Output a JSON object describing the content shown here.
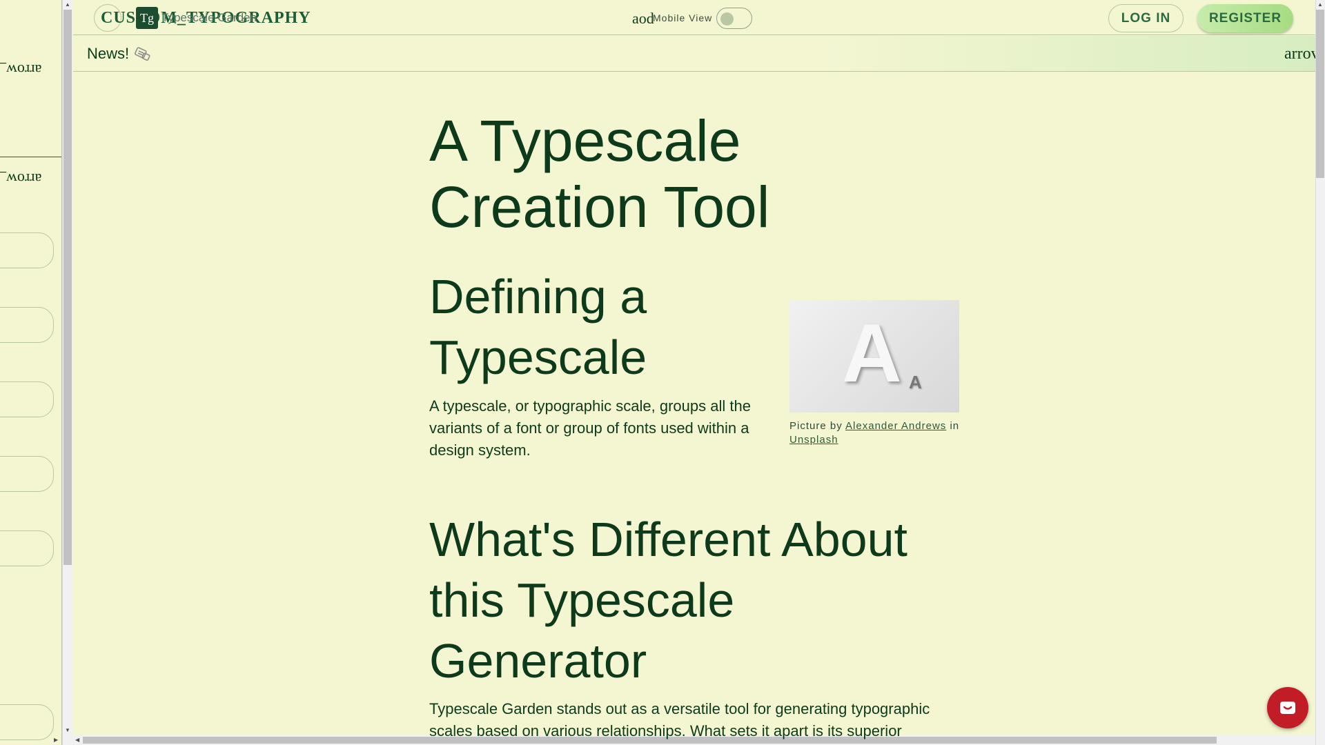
{
  "sidebar": {
    "arrow_label_1": "arrow_",
    "arrow_label_2": "arrow_"
  },
  "header": {
    "brand": "CUSTOM_TYPOGRAPHY",
    "logo_glyph": "Tg",
    "logo_alt_text": "Typescale Garden",
    "mode_icon_text": "aod",
    "mobile_view_label": "Mobile View",
    "mobile_view_on": false,
    "login_label": "LOG IN",
    "register_label": "REGISTER"
  },
  "news": {
    "label": "News!",
    "ticker_text": "arrov"
  },
  "article": {
    "title": "A Typescale Creation Tool",
    "section1_heading": "Defining a Typescale",
    "section1_text": "A typescale, or typographic scale, groups all the variants of a font or group of fonts used within a design system.",
    "figure": {
      "caption_prefix": "Picture by",
      "author": "Alexander Andrews",
      "caption_mid": "in",
      "source": "Unsplash",
      "big_letter": "A",
      "small_letter": "A"
    },
    "section2_heading": "What's Different About this Typescale Generator",
    "section2_text": "Typescale Garden stands out as a versatile tool for generating typographic scales based on various relationships. What sets it apart is its superior"
  },
  "colors": {
    "background": "#f4f6d2",
    "text": "#0e3a1c",
    "accent_green": "#2a6a3f",
    "chat_red": "#c21d27"
  }
}
